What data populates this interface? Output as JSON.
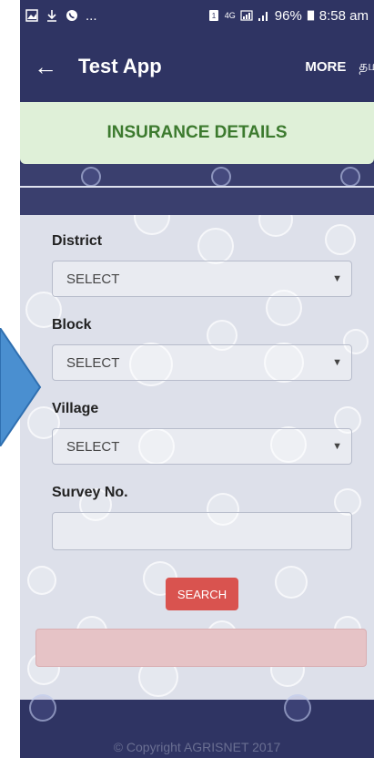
{
  "status_bar": {
    "left_icons": [
      "gallery-icon",
      "download-icon",
      "call-icon"
    ],
    "left_more": "...",
    "network": "4G",
    "battery": "96%",
    "time": "8:58 am"
  },
  "app_bar": {
    "back_glyph": "←",
    "title": "Test App",
    "more_label": "MORE",
    "language_label": "தமிழ்"
  },
  "banner": {
    "title": "INSURANCE DETAILS"
  },
  "form": {
    "district": {
      "label": "District",
      "selected": "SELECT"
    },
    "block": {
      "label": "Block",
      "selected": "SELECT"
    },
    "village": {
      "label": "Village",
      "selected": "SELECT"
    },
    "survey": {
      "label": "Survey No.",
      "value": ""
    },
    "caret": "▼",
    "search_label": "SEARCH"
  },
  "footer": {
    "copyright": "© Copyright AGRISNET 2017"
  },
  "colors": {
    "app_bar": "#2f3463",
    "banner_bg": "#dff0d8",
    "banner_text": "#3c7a2e",
    "search_button": "#d9534f",
    "result_bar": "#e6c3c6",
    "arrow": "#4a8fd0"
  }
}
